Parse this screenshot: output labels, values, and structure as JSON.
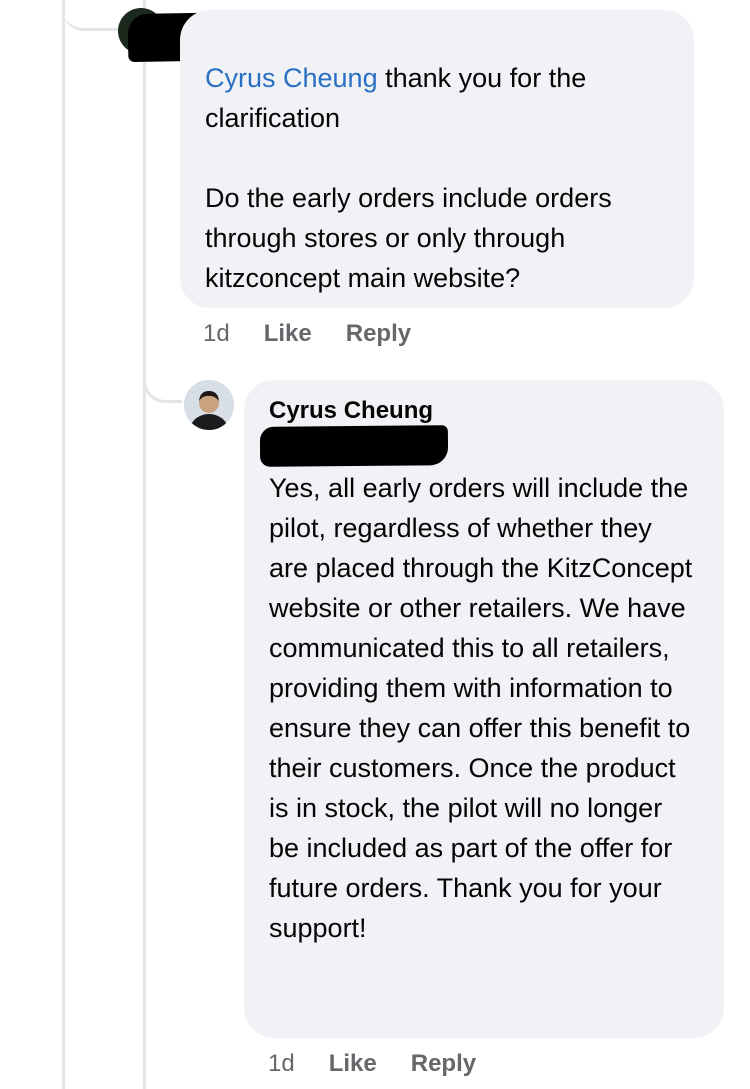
{
  "comment1": {
    "mention": "Cyrus Cheung",
    "text_after_mention": " thank you for the clarification",
    "paragraph2": "Do the early orders include orders through stores or only through kitzconcept main website?",
    "time": "1d",
    "like_label": "Like",
    "reply_label": "Reply"
  },
  "comment2": {
    "author": "Cyrus Cheung",
    "text": "Yes, all early orders will include the pilot, regardless of whether they are placed through the KitzConcept website or other retailers. We have communicated this to all retailers, providing them with information to ensure they can offer this benefit to their customers. Once the product is in stock, the pilot will no longer be included as part of the offer for future orders. Thank you for your support!",
    "time": "1d",
    "like_label": "Like",
    "reply_label": "Reply"
  },
  "colors": {
    "bubble": "#f0f2f5",
    "mention": "#2a6fc4",
    "meta": "#65676b",
    "redaction": "#000000"
  },
  "icons": {
    "avatar": "user-avatar"
  }
}
